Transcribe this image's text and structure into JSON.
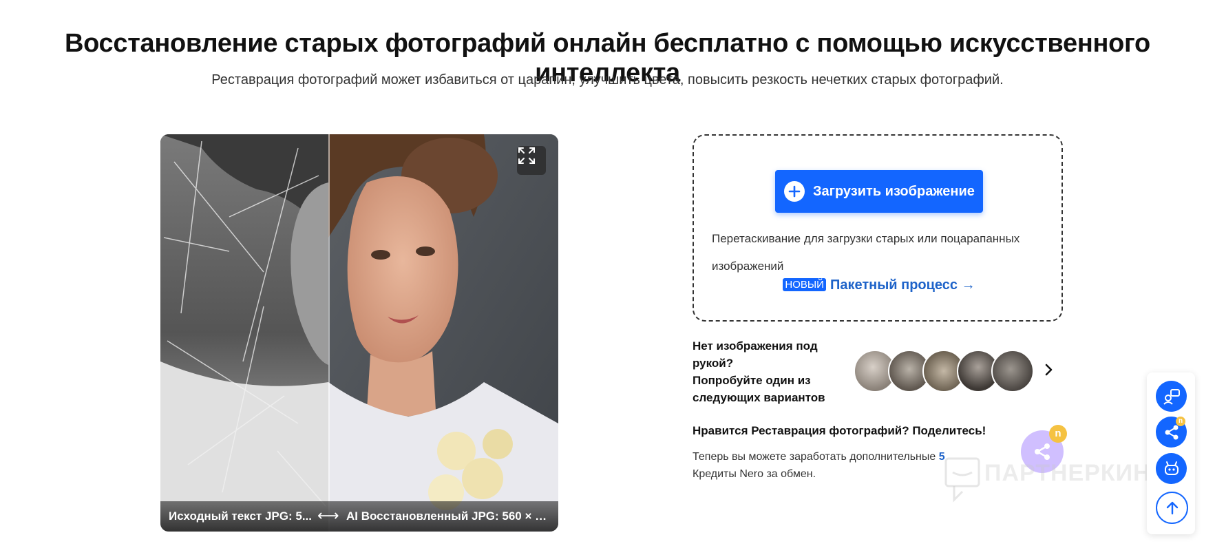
{
  "header": {
    "title": "Восстановление старых фотографий онлайн бесплатно с помощью искусственного интеллекта",
    "subtitle": "Реставрация фотографий может избавиться от царапин, улучшить цвета, повысить резкость нечетких старых фотографий."
  },
  "viewer": {
    "left_caption": "Исходный текст JPG: 5...",
    "arrow": "⟷",
    "right_caption": "AI Восстановленный JPG: 560 × 56...",
    "expand_icon": "expand-icon"
  },
  "upload": {
    "button_label": "Загрузить изображение",
    "drop_text": "Перетаскивание для загрузки старых или поцарапанных изображений",
    "badge": "НОВЫЙ",
    "batch_link": "Пакетный процесс →"
  },
  "samples": {
    "label_line1": "Нет изображения под рукой?",
    "label_line2": "Попробуйте один из следующих вариантов"
  },
  "share": {
    "title": "Нравится Реставрация фотографий? Поделитесь!",
    "text_before": "Теперь вы можете заработать дополнительные ",
    "credits": "5",
    "text_after": " Кредиты Nero за обмен.",
    "coin_letter": "n"
  },
  "watermark": {
    "text": "ПАРТНЕРКИН"
  },
  "rail": {
    "dot_letter": "n"
  },
  "colors": {
    "accent": "#1366ff",
    "link": "#1e63c9"
  }
}
